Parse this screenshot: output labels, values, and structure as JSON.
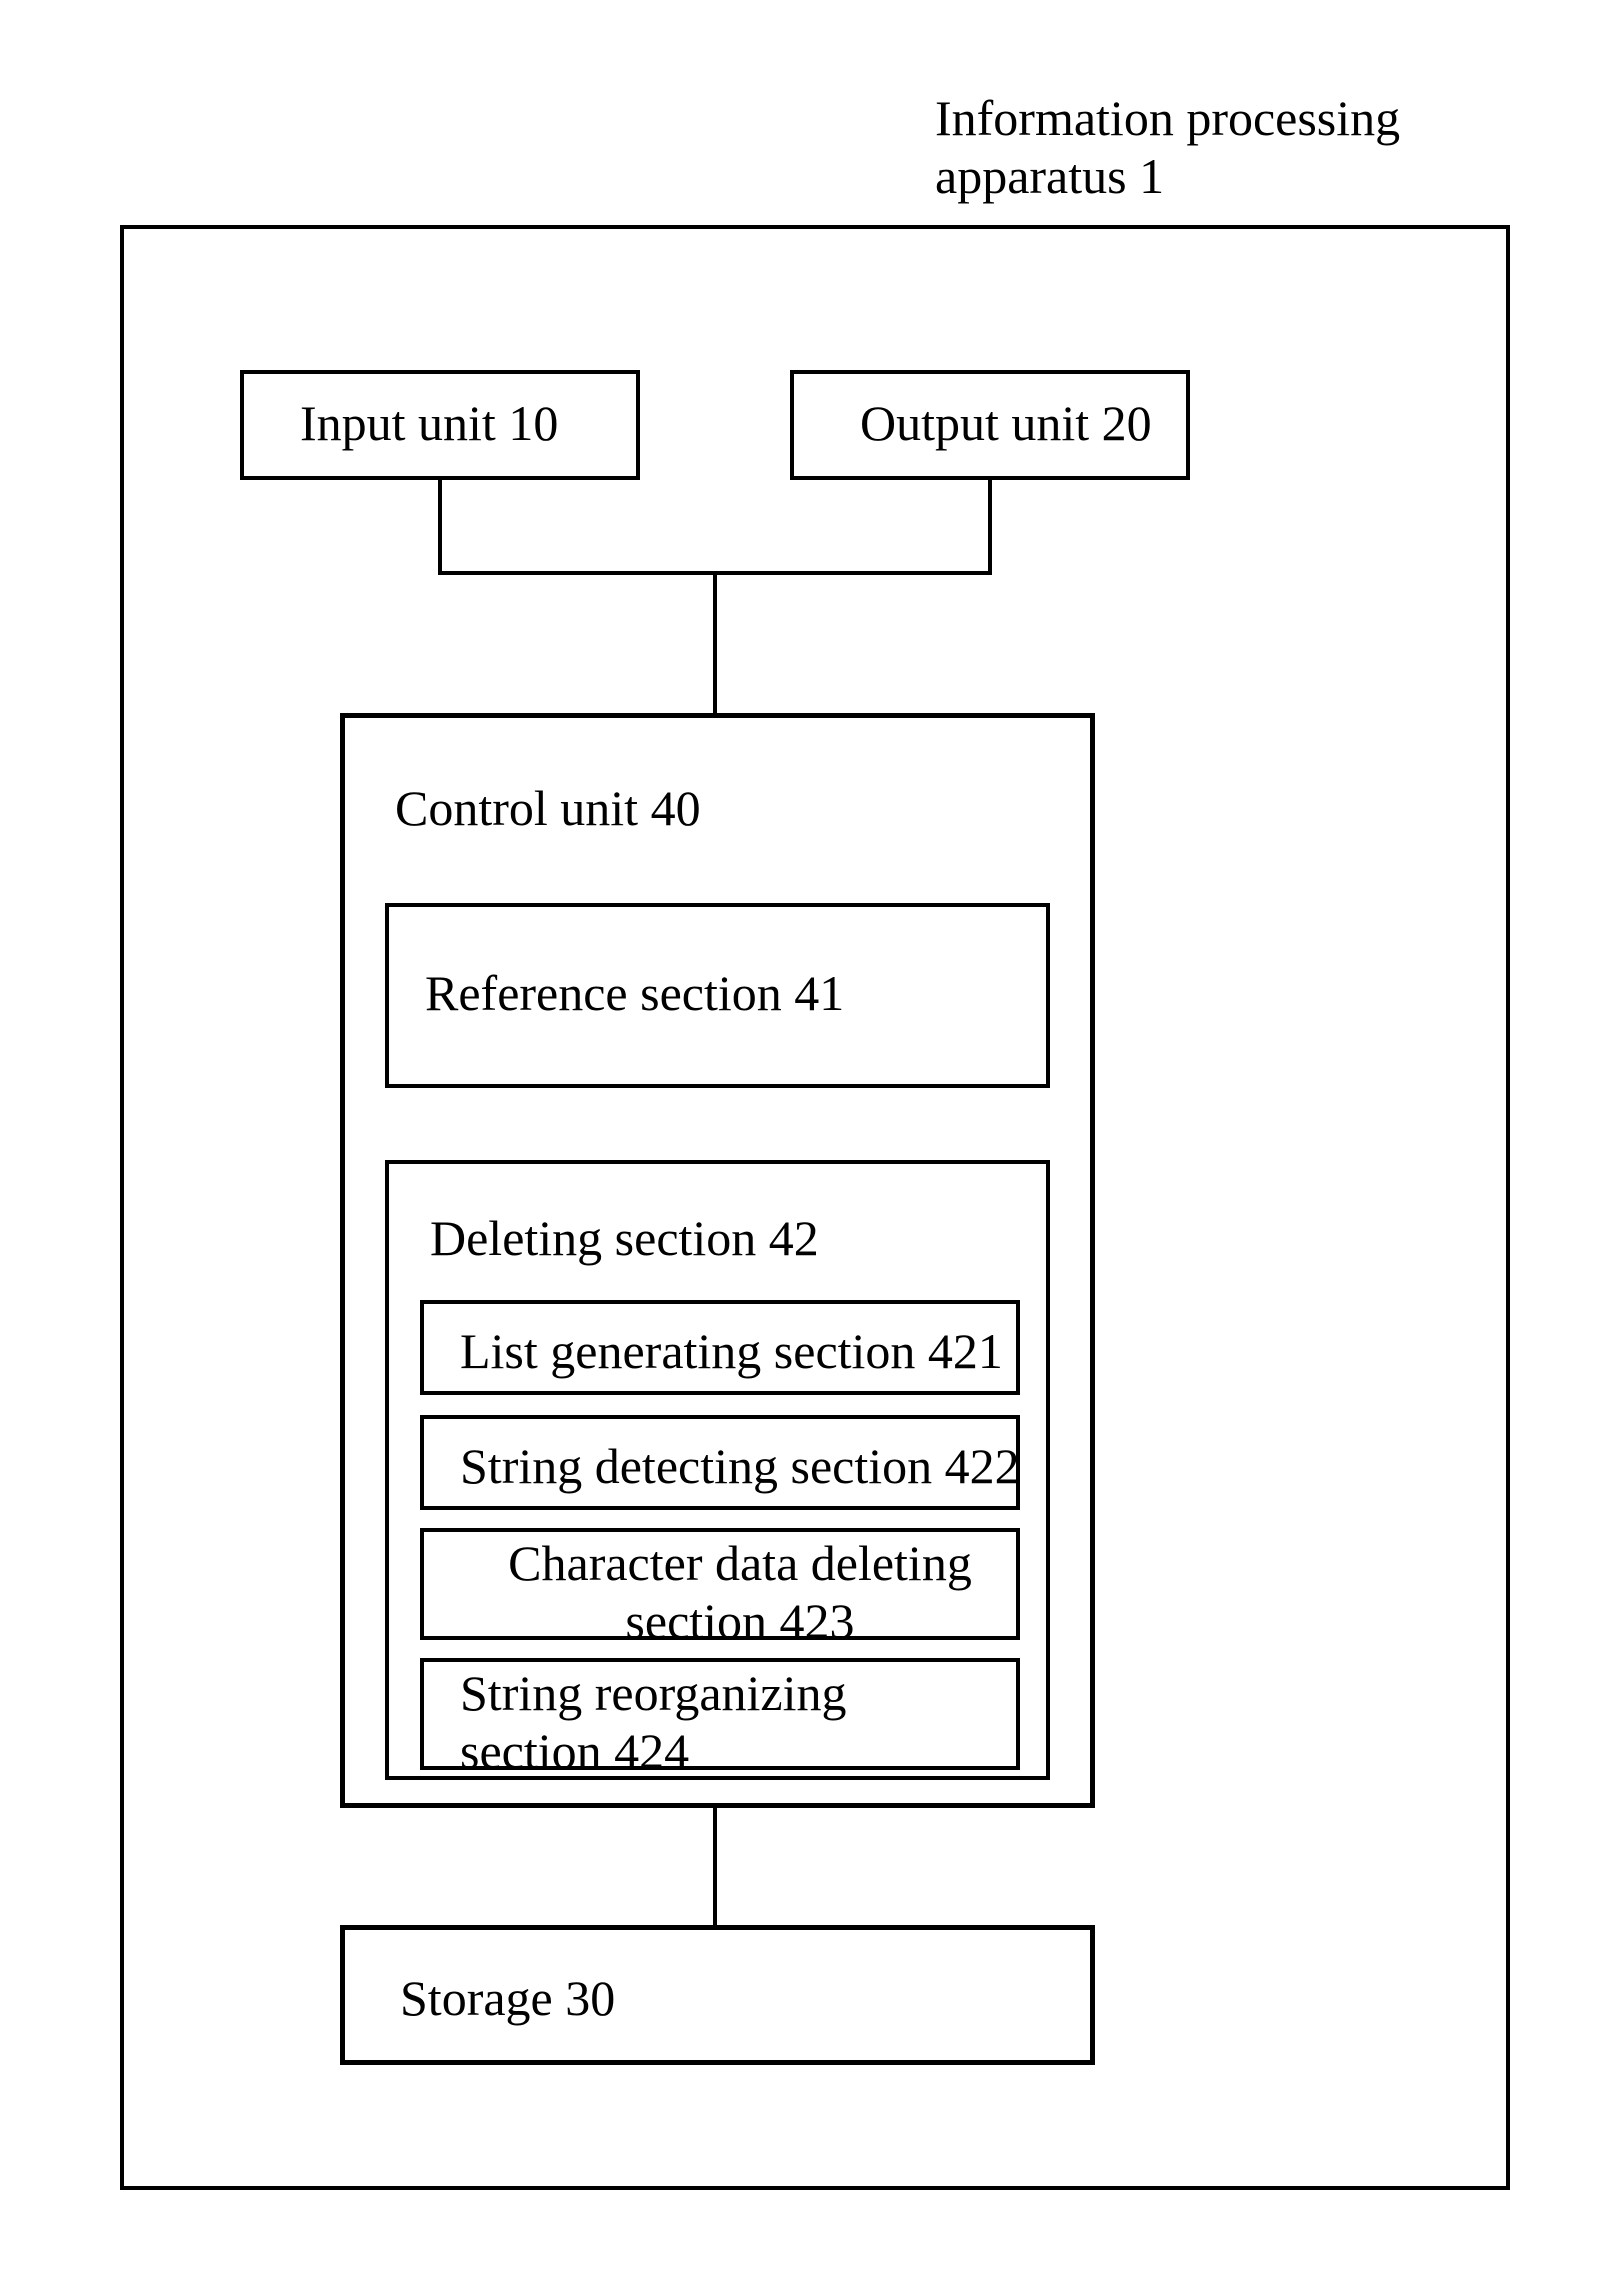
{
  "title": "Information processing\napparatus 1",
  "blocks": {
    "input_unit": "Input unit 10",
    "output_unit": "Output unit 20",
    "control_unit": "Control unit 40",
    "reference_section": "Reference section 41",
    "deleting_section": "Deleting section 42",
    "list_generating": "List generating section 421",
    "string_detecting": "String detecting section 422",
    "char_data_deleting": "Character data deleting section 423",
    "string_reorganizing": "String reorganizing section 424",
    "storage": "Storage 30"
  }
}
